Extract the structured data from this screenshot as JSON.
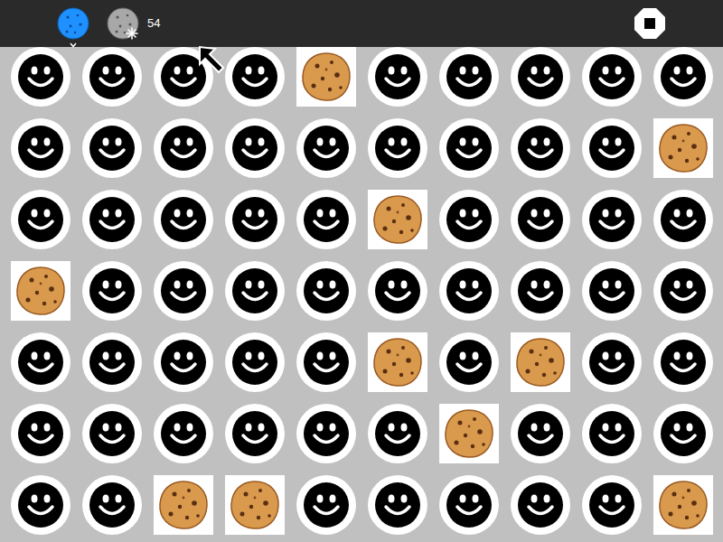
{
  "toolbar": {
    "tools": [
      {
        "kind": "blue",
        "selected": true
      },
      {
        "kind": "grey",
        "selected": false
      }
    ],
    "count": "54"
  },
  "grid": {
    "rows": [
      [
        "smiley",
        "smiley",
        "smiley",
        "smiley",
        "cookie",
        "smiley",
        "smiley",
        "smiley",
        "smiley",
        "smiley"
      ],
      [
        "smiley",
        "smiley",
        "smiley",
        "smiley",
        "smiley",
        "smiley",
        "smiley",
        "smiley",
        "smiley",
        "cookie"
      ],
      [
        "smiley",
        "smiley",
        "smiley",
        "smiley",
        "smiley",
        "cookie",
        "smiley",
        "smiley",
        "smiley",
        "smiley"
      ],
      [
        "cookie",
        "smiley",
        "smiley",
        "smiley",
        "smiley",
        "smiley",
        "smiley",
        "smiley",
        "smiley",
        "smiley"
      ],
      [
        "smiley",
        "smiley",
        "smiley",
        "smiley",
        "smiley",
        "cookie",
        "smiley",
        "cookie",
        "smiley",
        "smiley"
      ],
      [
        "smiley",
        "smiley",
        "smiley",
        "smiley",
        "smiley",
        "smiley",
        "cookie",
        "smiley",
        "smiley",
        "smiley"
      ],
      [
        "smiley",
        "smiley",
        "cookie",
        "cookie",
        "smiley",
        "smiley",
        "smiley",
        "smiley",
        "smiley",
        "cookie"
      ]
    ]
  }
}
